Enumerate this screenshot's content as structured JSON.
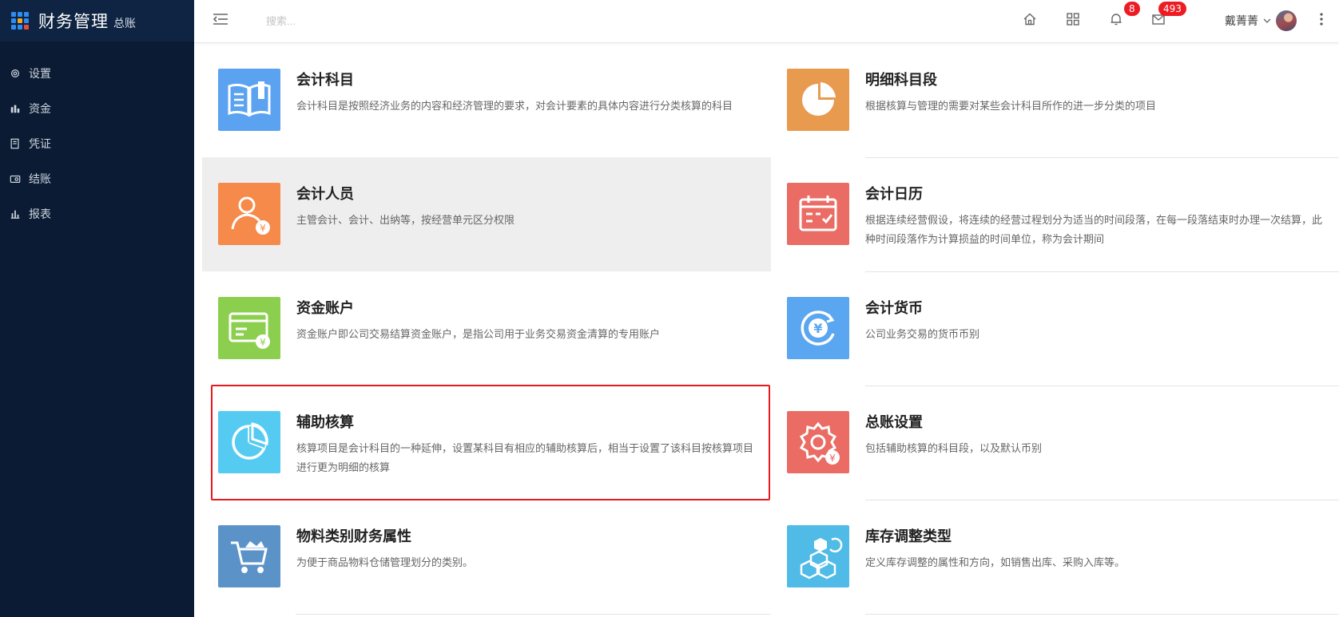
{
  "app": {
    "title": "财务管理",
    "subtitle": "总账"
  },
  "sidebar": {
    "items": [
      {
        "label": "设置",
        "icon": "gear-icon"
      },
      {
        "label": "资金",
        "icon": "funds-icon"
      },
      {
        "label": "凭证",
        "icon": "voucher-icon"
      },
      {
        "label": "结账",
        "icon": "checkout-icon"
      },
      {
        "label": "报表",
        "icon": "report-icon"
      }
    ]
  },
  "header": {
    "search_placeholder": "搜索...",
    "notifications_count": "8",
    "messages_count": "493",
    "username": "戴菁菁"
  },
  "cards": [
    {
      "title": "会计科目",
      "desc": "会计科目是按照经济业务的内容和经济管理的要求，对会计要素的具体内容进行分类核算的科目",
      "icon": "book-icon",
      "color": "#5ba3f0"
    },
    {
      "title": "明细科目段",
      "desc": "根据核算与管理的需要对某些会计科目所作的进一步分类的项目",
      "icon": "pie-chart-icon",
      "color": "#e89a4f"
    },
    {
      "title": "会计人员",
      "desc": "主管会计、会计、出纳等，按经营单元区分权限",
      "icon": "accountant-icon",
      "color": "#f58a4a"
    },
    {
      "title": "会计日历",
      "desc": "根据连续经营假设，将连续的经营过程划分为适当的时间段落，在每一段落结束时办理一次结算，此种时间段落作为计算损益的时间单位，称为会计期间",
      "icon": "calendar-icon",
      "color": "#ea6c64"
    },
    {
      "title": "资金账户",
      "desc": "资金账户即公司交易结算资金账户，是指公司用于业务交易资金清算的专用账户",
      "icon": "fund-card-icon",
      "color": "#8ccf4f"
    },
    {
      "title": "会计货币",
      "desc": "公司业务交易的货币币别",
      "icon": "currency-icon",
      "color": "#5aa6f0"
    },
    {
      "title": "辅助核算",
      "desc": "核算项目是会计科目的一种延伸，设置某科目有相应的辅助核算后，相当于设置了该科目按核算项目进行更为明细的核算",
      "icon": "aux-pie-icon",
      "color": "#55cbf2"
    },
    {
      "title": "总账设置",
      "desc": "包括辅助核算的科目段，以及默认币别",
      "icon": "settings-yuan-icon",
      "color": "#ea6c64"
    },
    {
      "title": "物料类别财务属性",
      "desc": "为便于商品物料仓储管理划分的类别。",
      "icon": "cart-icon",
      "color": "#5b93c9"
    },
    {
      "title": "库存调整类型",
      "desc": "定义库存调整的属性和方向，如销售出库、采购入库等。",
      "icon": "boxes-icon",
      "color": "#4fbbe6"
    }
  ],
  "colors": {
    "sidebar_bg": "#0a1b33",
    "badge": "#ed1c24",
    "selection": "#e8191e"
  }
}
